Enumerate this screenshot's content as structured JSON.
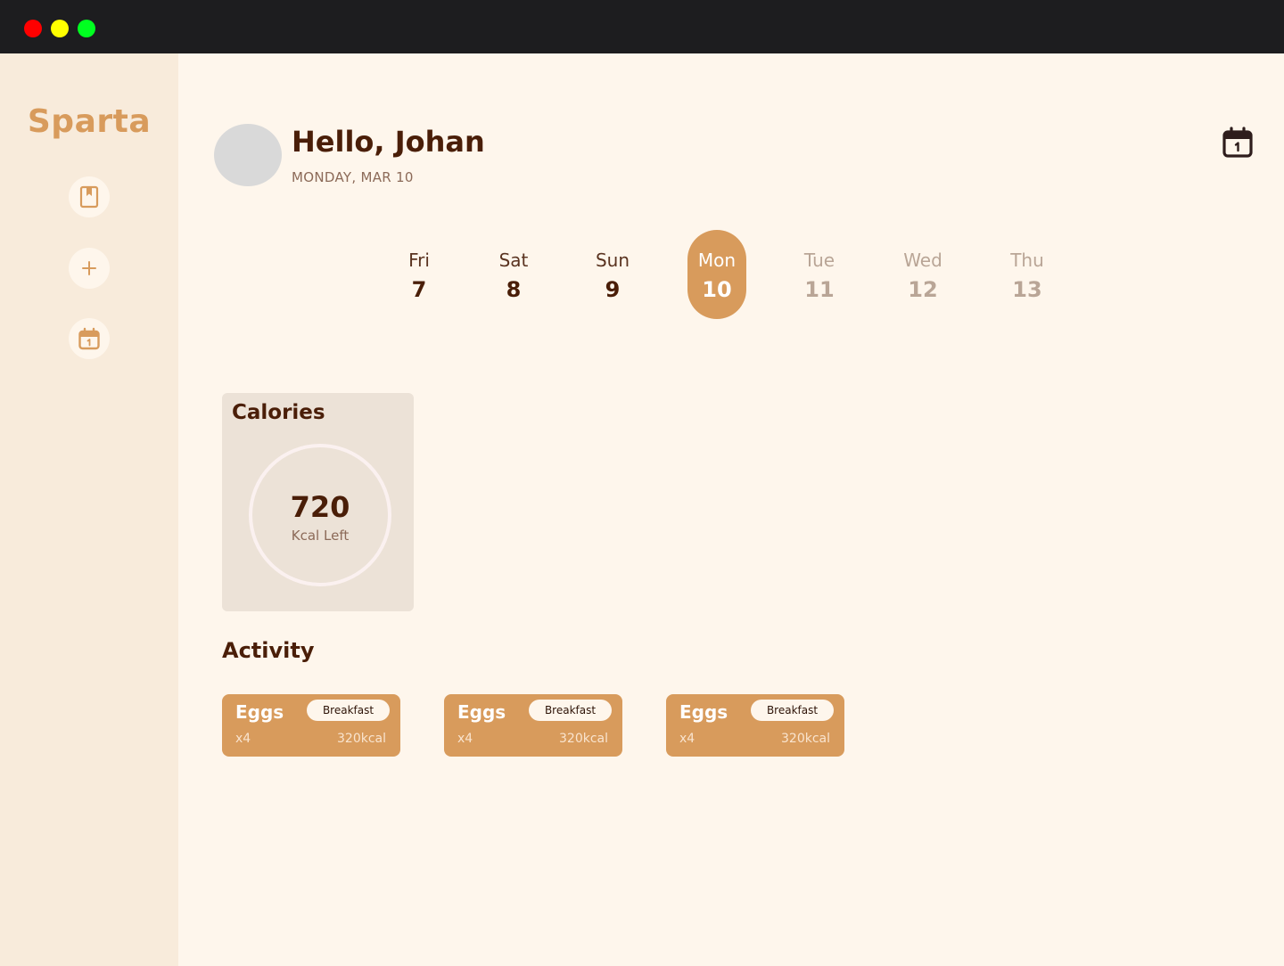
{
  "app": {
    "brand": "Sparta"
  },
  "sidebar": {
    "items": [
      {
        "name": "journal",
        "icon": "book-icon"
      },
      {
        "name": "add",
        "icon": "plus-icon"
      },
      {
        "name": "calendar",
        "icon": "calendar-icon"
      }
    ]
  },
  "header": {
    "greeting": "Hello, ",
    "user_name": "Johan",
    "date": "MONDAY, MAR 10",
    "calendar_icon": "calendar-icon"
  },
  "days": [
    {
      "name": "Fri",
      "num": "7",
      "state": "past"
    },
    {
      "name": "Sat",
      "num": "8",
      "state": "past"
    },
    {
      "name": "Sun",
      "num": "9",
      "state": "past"
    },
    {
      "name": "Mon",
      "num": "10",
      "state": "active"
    },
    {
      "name": "Tue",
      "num": "11",
      "state": "future"
    },
    {
      "name": "Wed",
      "num": "12",
      "state": "future"
    },
    {
      "name": "Thu",
      "num": "13",
      "state": "future"
    }
  ],
  "calories": {
    "title": "Calories",
    "value": "720",
    "label": "Kcal Left"
  },
  "activity": {
    "title": "Activity",
    "items": [
      {
        "food": "Eggs",
        "tag": "Breakfast",
        "qty": "x4",
        "kcal": "320kcal"
      },
      {
        "food": "Eggs",
        "tag": "Breakfast",
        "qty": "x4",
        "kcal": "320kcal"
      },
      {
        "food": "Eggs",
        "tag": "Breakfast",
        "qty": "x4",
        "kcal": "320kcal"
      }
    ]
  },
  "colors": {
    "accent": "#d89b5c",
    "text_dark": "#4a1e08",
    "background": "#fef6ec",
    "sidebar": "#f8ebdb",
    "card": "#ece2d7"
  }
}
